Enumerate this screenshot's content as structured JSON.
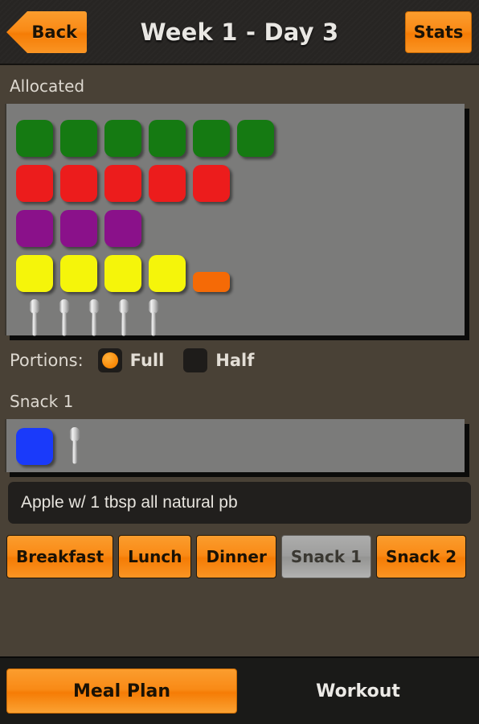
{
  "header": {
    "back_label": "Back",
    "title": "Week 1 - Day 3",
    "stats_label": "Stats"
  },
  "allocated": {
    "label": "Allocated",
    "rows": [
      {
        "name": "green-row",
        "color": "#157a12",
        "count": 6,
        "half": 0
      },
      {
        "name": "red-row",
        "color": "#ec1c1c",
        "count": 5,
        "half": 0
      },
      {
        "name": "purple-row",
        "color": "#8a118a",
        "count": 3,
        "half": 0
      },
      {
        "name": "yellow-row",
        "color": "#f5f50a",
        "count": 4,
        "half": 1,
        "half_color": "#f56a06"
      },
      {
        "name": "spoon-row",
        "color": "spoon",
        "count": 5,
        "half": 0
      }
    ]
  },
  "portions": {
    "label": "Portions:",
    "options": [
      {
        "label": "Full",
        "selected": true
      },
      {
        "label": "Half",
        "selected": false
      }
    ]
  },
  "snack": {
    "label": "Snack 1",
    "tiles": [
      {
        "name": "blue-tile",
        "color": "#1a3afa",
        "count": 1
      },
      {
        "name": "spoon",
        "color": "spoon",
        "count": 1
      }
    ],
    "description": "Apple w/ 1 tbsp all natural pb"
  },
  "meal_buttons": [
    {
      "label": "Breakfast",
      "selected": false
    },
    {
      "label": "Lunch",
      "selected": false
    },
    {
      "label": "Dinner",
      "selected": false
    },
    {
      "label": "Snack 1",
      "selected": true
    },
    {
      "label": "Snack 2",
      "selected": false
    }
  ],
  "tabbar": [
    {
      "label": "Meal Plan",
      "active": true
    },
    {
      "label": "Workout",
      "active": false
    }
  ],
  "colors": {
    "accent": "#f98a16",
    "background": "#494136",
    "panel": "#7b7b7a",
    "header": "#272523",
    "tabbar": "#1a1a18"
  }
}
